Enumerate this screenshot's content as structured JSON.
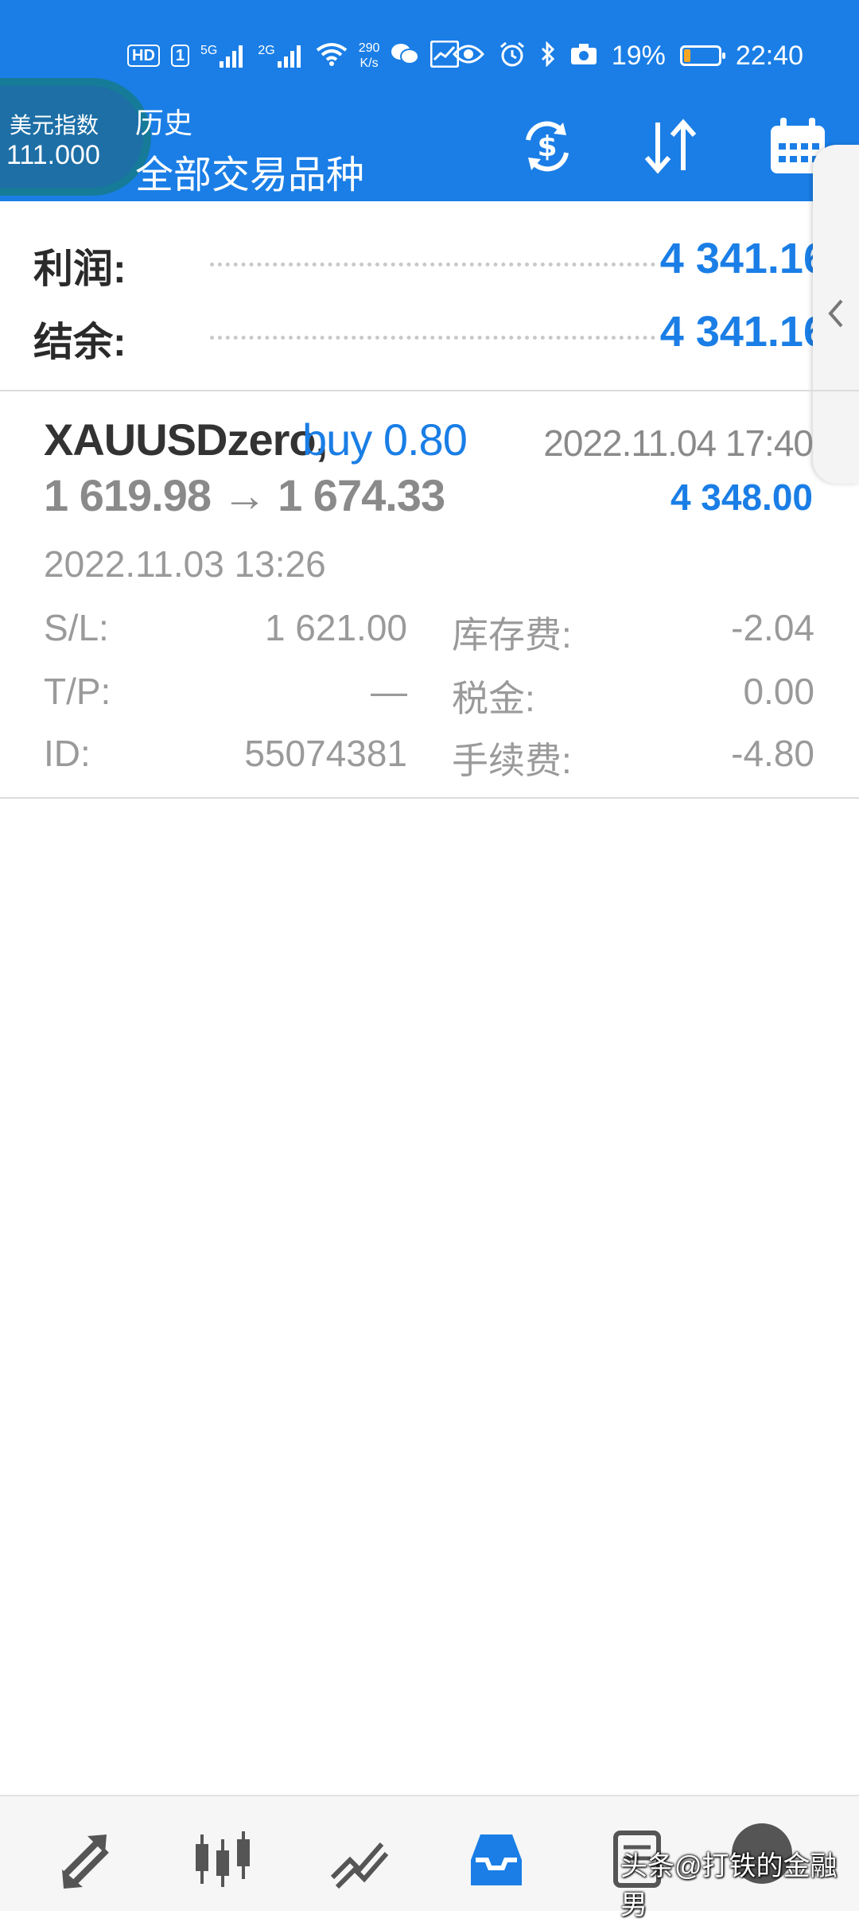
{
  "status_bar": {
    "hd_badge": "HD",
    "sim_badge": "1",
    "net_5g": "5G",
    "net_2g": "2G",
    "speed_value": "290",
    "speed_unit": "K/s",
    "battery_percent": "19%",
    "battery_level": 0.19,
    "time": "22:40"
  },
  "overlay_widget": {
    "label": "美元指数",
    "value": "111.000"
  },
  "header": {
    "subtitle": "历史",
    "title": "全部交易品种",
    "icons": [
      "currency-sync-icon",
      "sort-icon",
      "calendar-icon"
    ],
    "background": "#1a7ee6"
  },
  "summary": {
    "profit_label": "利润:",
    "profit_value": "4 341.16",
    "balance_label": "结余:",
    "balance_value": "4 341.16"
  },
  "trade": {
    "symbol": "XAUUSDzero,",
    "direction": "buy 0.80",
    "close_time": "2022.11.04 17:40",
    "prices": "1 619.98 → 1 674.33",
    "profit": "4 348.00",
    "open_time": "2022.11.03 13:26",
    "details": {
      "sl_label": "S/L:",
      "sl_value": "1 621.00",
      "swap_label": "库存费:",
      "swap_value": "-2.04",
      "tp_label": "T/P:",
      "tp_value": "—",
      "tax_label": "税金:",
      "tax_value": "0.00",
      "id_label": "ID:",
      "id_value": "55074381",
      "fee_label": "手续费:",
      "fee_value": "-4.80"
    }
  },
  "bottom_nav": {
    "items": [
      "quotes-icon",
      "chart-icon",
      "trade-icon",
      "history-icon",
      "messages-icon",
      "chat-icon"
    ],
    "active": "history-icon",
    "accent": "#1a7ee6"
  },
  "watermark": "头条@打铁的金融男"
}
